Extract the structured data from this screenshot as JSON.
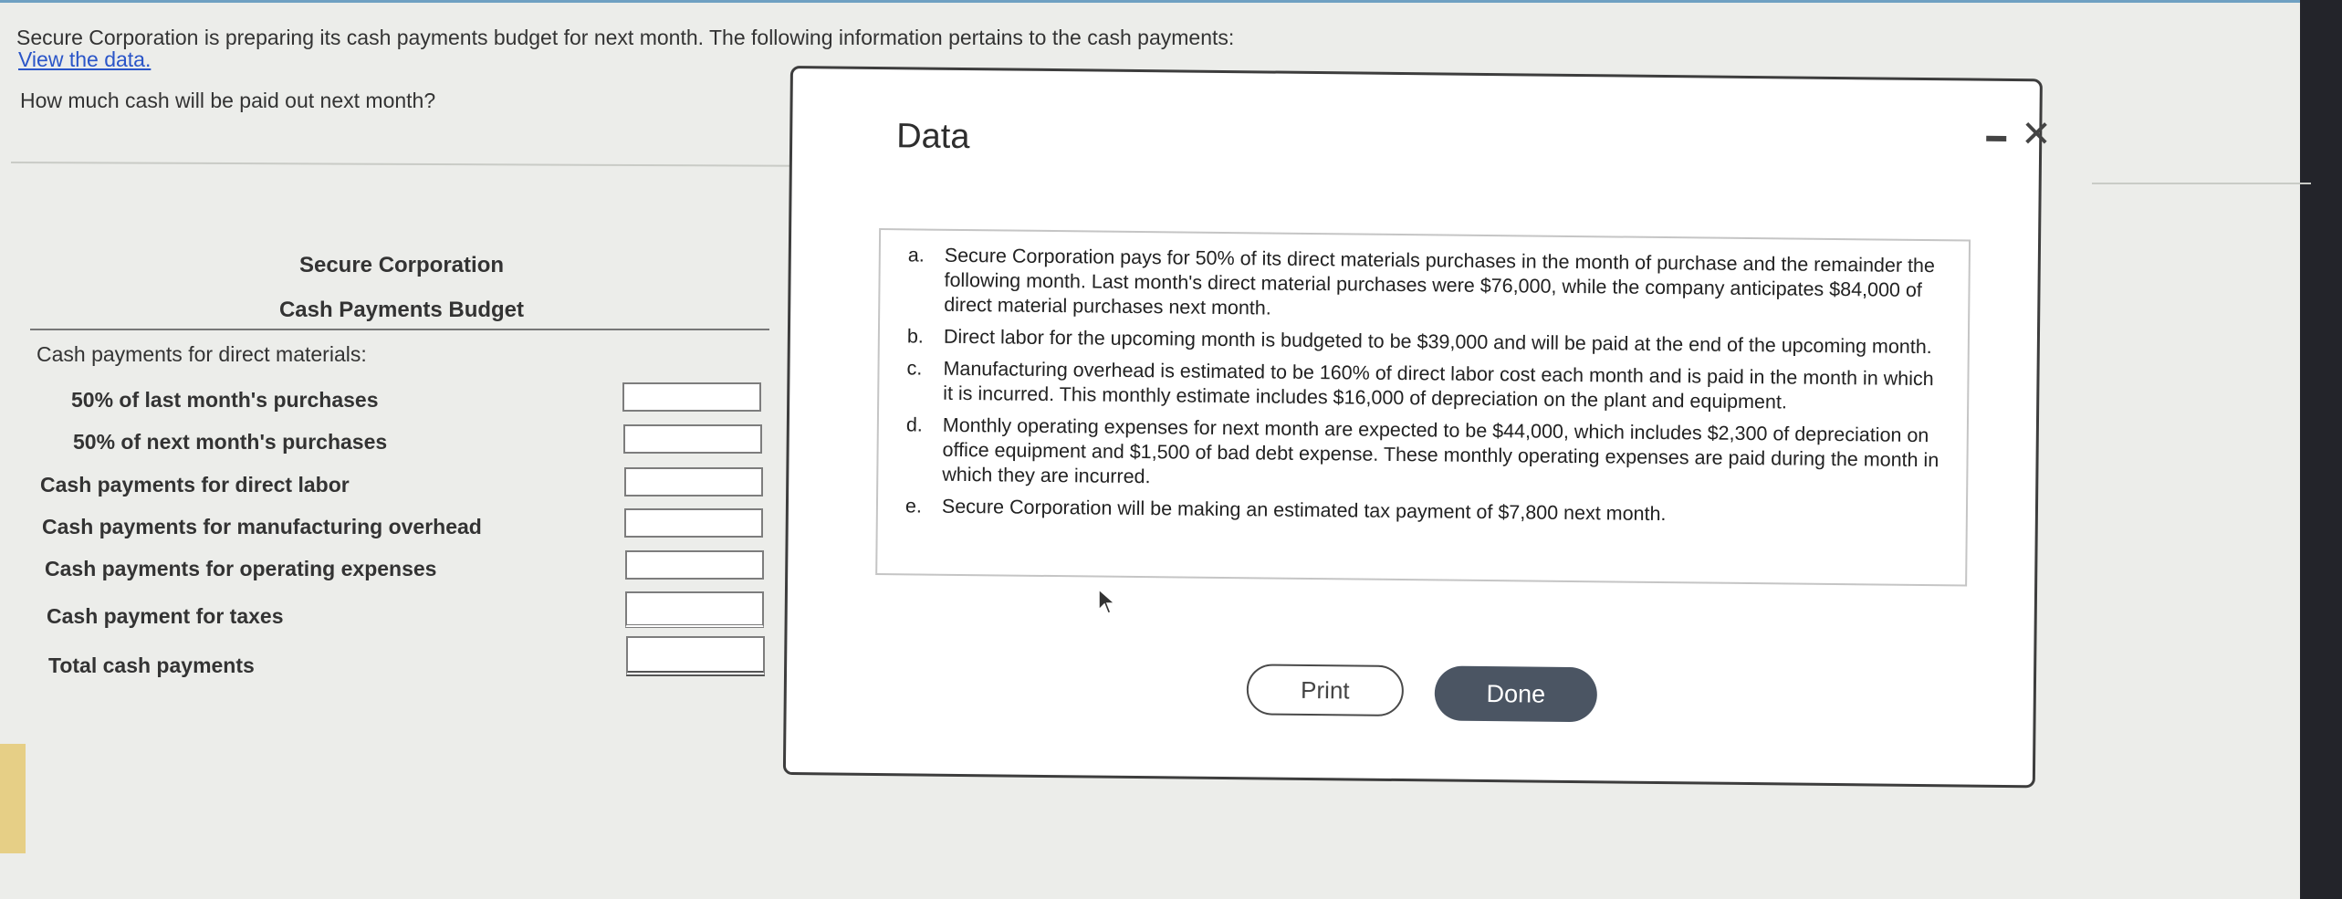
{
  "intro_text": "Secure Corporation is preparing its cash payments budget for next month. The following information pertains to the cash payments:",
  "view_data_link": "View the data.",
  "question": "How much cash will be paid out next month?",
  "budget": {
    "company": "Secure Corporation",
    "title": "Cash Payments Budget",
    "rows": [
      {
        "label": "Cash payments for direct materials:",
        "input": false
      },
      {
        "label": "50% of last month's purchases",
        "input": true
      },
      {
        "label": "50% of next month's purchases",
        "input": true
      },
      {
        "label": "Cash payments for direct labor",
        "input": true
      },
      {
        "label": "Cash payments for manufacturing overhead",
        "input": true
      },
      {
        "label": "Cash payments for operating expenses",
        "input": true
      },
      {
        "label": "Cash payment for taxes",
        "input": true
      },
      {
        "label": "Total cash payments",
        "input": true
      }
    ]
  },
  "modal": {
    "title": "Data",
    "minimize_icon": "minimize-icon",
    "close_icon": "close-icon",
    "items": [
      {
        "letter": "a.",
        "text": "Secure Corporation pays for 50% of its direct materials purchases in the month of purchase and the remainder the following month. Last month's direct material purchases were $76,000, while the company anticipates $84,000 of direct material purchases next month."
      },
      {
        "letter": "b.",
        "text": "Direct labor for the upcoming month is budgeted to be $39,000 and will be paid at the end of the upcoming month."
      },
      {
        "letter": "c.",
        "text": "Manufacturing overhead is estimated to be 160% of direct labor cost each month and is paid in the month in which it is incurred. This monthly estimate includes $16,000 of depreciation on the plant and equipment."
      },
      {
        "letter": "d.",
        "text": "Monthly operating expenses for next month are expected to be $44,000, which includes $2,300 of depreciation on office equipment and $1,500 of bad debt expense. These monthly operating expenses are paid during the month in which they are incurred."
      },
      {
        "letter": "e.",
        "text": "Secure Corporation will be making an estimated tax payment of $7,800 next month."
      }
    ],
    "print_label": "Print",
    "done_label": "Done"
  },
  "colors": {
    "link": "#2a55c8",
    "done_button": "#4b5563",
    "background": "#ecedea"
  }
}
